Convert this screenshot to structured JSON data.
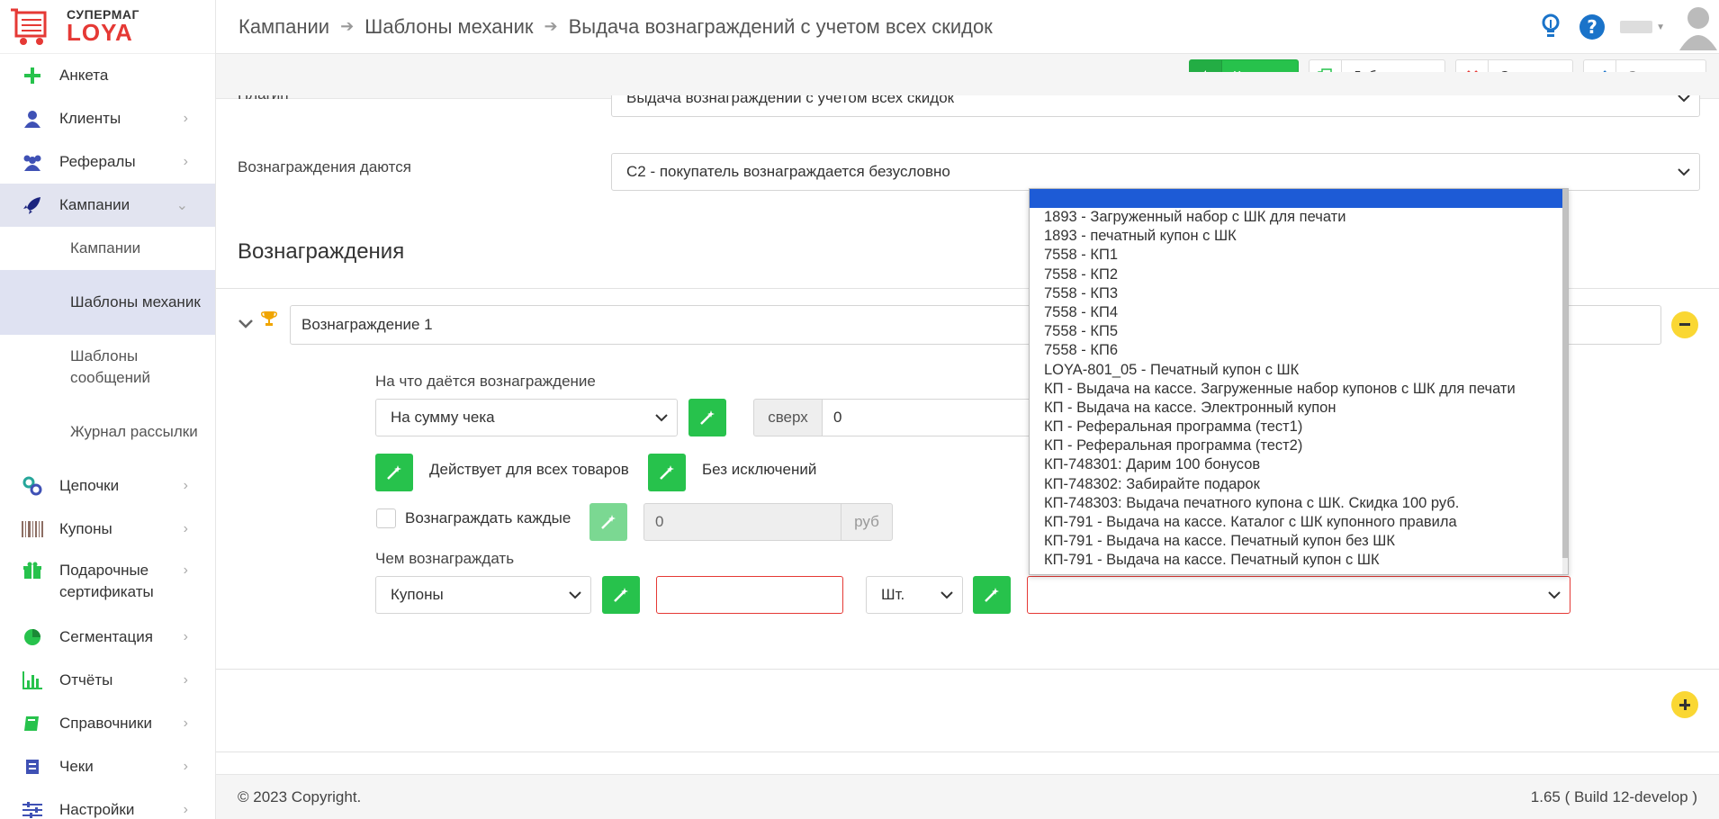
{
  "brand": {
    "top": "СУПЕРМАГ",
    "bottom": "LOYA",
    "accent": "#e53935"
  },
  "sidebar": {
    "items": [
      {
        "label": "Анкета",
        "icon": "plus-icon"
      },
      {
        "label": "Клиенты",
        "icon": "user-icon"
      },
      {
        "label": "Рефералы",
        "icon": "users-icon"
      },
      {
        "label": "Кампании",
        "icon": "rocket-icon"
      },
      {
        "label": "Цепочки",
        "icon": "link-icon"
      },
      {
        "label": "Купоны",
        "icon": "barcode-icon"
      },
      {
        "label": "Подарочные сертификаты",
        "icon": "gift-icon"
      },
      {
        "label": "Сегментация",
        "icon": "pie-chart-icon"
      },
      {
        "label": "Отчёты",
        "icon": "bar-chart-icon"
      },
      {
        "label": "Справочники",
        "icon": "book-icon"
      },
      {
        "label": "Чеки",
        "icon": "receipt-icon"
      },
      {
        "label": "Настройки",
        "icon": "sliders-icon"
      }
    ],
    "sub_items": [
      {
        "label": "Кампании"
      },
      {
        "label": "Шаблоны механик"
      },
      {
        "label": "Шаблоны сообщений"
      },
      {
        "label": "Журнал рассылки"
      }
    ]
  },
  "breadcrumb": [
    "Кампании",
    "Шаблоны механик",
    "Выдача вознаграждений с учетом всех скидок"
  ],
  "toolbar": {
    "to_list": "К списку",
    "duplicate": "Дублировать",
    "cancel": "Отменить",
    "save": "Сохранить"
  },
  "form": {
    "plugin_label": "Плагин",
    "plugin_value": "Выдача вознаграждений с учетом всех скидок",
    "rewards_given_label": "Вознаграждения даются",
    "rewards_given_value": "С2 - покупатель вознаграждается безусловно",
    "section_title": "Вознаграждения",
    "reward_name": "Вознаграждение 1",
    "reward_for_label": "На что даётся вознаграждение",
    "reward_for_value": "На сумму чека",
    "above_label": "сверх",
    "above_value": "0",
    "all_goods_text": "Действует для всех товаров",
    "no_exceptions_text": "Без исключений",
    "reward_every_label": "Вознаграждать каждые",
    "reward_every_value": "0",
    "reward_every_unit": "руб",
    "reward_with_label": "Чем вознаграждать",
    "reward_with_value": "Купоны",
    "qty_unit_value": "Шт.",
    "coupon_qty_value": "",
    "coupon_select_value": ""
  },
  "dropdown_options": [
    "1893 - Загруженный набор с ШК для печати",
    "1893 - печатный купон с ШК",
    "7558 - КП1",
    "7558 - КП2",
    "7558 - КП3",
    "7558 - КП4",
    "7558 - КП5",
    "7558 - КП6",
    "LOYA-801_05 - Печатный купон с ШК",
    "КП - Выдача на кассе. Загруженные набор купонов с ШК для печати",
    "КП - Выдача на кассе. Электронный купон",
    "КП - Реферальная программа (тест1)",
    "КП - Реферальная программа (тест2)",
    "КП-748301: Дарим 100 бонусов",
    "КП-748302: Забирайте подарок",
    "КП-748303: Выдача печатного купона с ШК. Скидка 100 руб.",
    "КП-791 - Выдача на кассе. Каталог с ШК купонного правила",
    "КП-791 - Выдача на кассе. Печатный купон без ШК",
    "КП-791 - Выдача на кассе. Печатный купон с ШК"
  ],
  "footer": {
    "copyright": "© 2023 Copyright.",
    "version": "1.65 ( Build 12-develop )"
  },
  "colors": {
    "green": "#27c24c",
    "yellow": "#fad733",
    "selection": "#1d5bd6",
    "invalid": "#e53935"
  }
}
